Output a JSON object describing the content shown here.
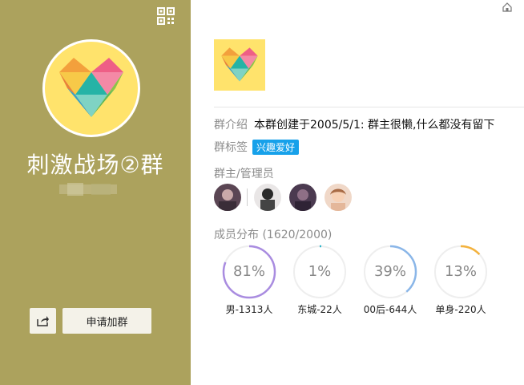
{
  "group": {
    "name": "刺激战场②群"
  },
  "actions": {
    "join_label": "申请加群"
  },
  "info": {
    "intro_label": "群介绍",
    "intro_value": "本群创建于2005/5/1:  群主很懒,什么都没有留下",
    "tags_label": "群标签",
    "tag_value": "兴趣爱好",
    "admins_label": "群主/管理员",
    "members_label": "成员分布 (1620/2000)"
  },
  "stats": [
    {
      "percent_text": "81%",
      "fraction": 0.81,
      "color": "#a98ce0",
      "label": "男-1313人"
    },
    {
      "percent_text": "1%",
      "fraction": 0.01,
      "color": "#2bb3c9",
      "label": "东城-22人"
    },
    {
      "percent_text": "39%",
      "fraction": 0.39,
      "color": "#8ab6e8",
      "label": "00后-644人"
    },
    {
      "percent_text": "13%",
      "fraction": 0.13,
      "color": "#f3b23d",
      "label": "单身-220人"
    }
  ],
  "colors": {
    "left_panel": "#aca25d",
    "avatar_bg": "#ffe36c",
    "tag_bg": "#17a1ea",
    "ring_track": "#eeeeee"
  },
  "icons": {
    "qr": "qr-code-icon",
    "share": "share-icon",
    "home": "home-icon"
  }
}
